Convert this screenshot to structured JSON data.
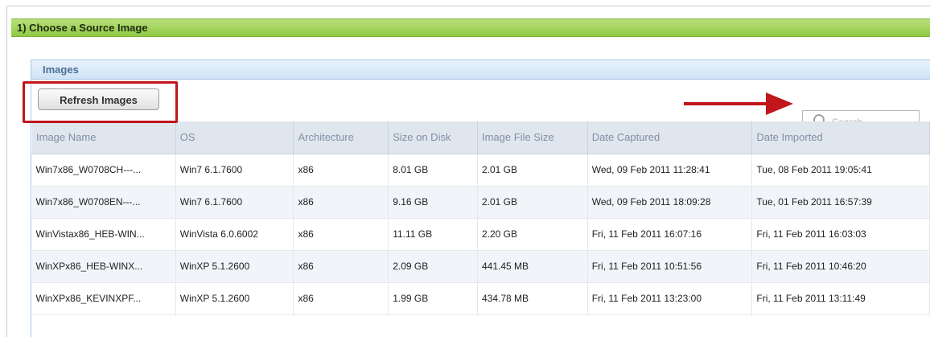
{
  "section": {
    "title": "1) Choose a Source Image"
  },
  "panel": {
    "title": "Images"
  },
  "toolbar": {
    "refresh_label": "Refresh Images"
  },
  "search": {
    "placeholder": "Search"
  },
  "colors": {
    "section_header": "#8fc944",
    "panel_border": "#a9c8e6",
    "highlight": "#c0161c"
  },
  "icons": {
    "search": "search-icon",
    "arrow": "red-arrow-annotation"
  },
  "table": {
    "columns": [
      "Image Name",
      "OS",
      "Architecture",
      "Size on Disk",
      "Image File Size",
      "Date Captured",
      "Date Imported"
    ],
    "rows": [
      [
        "Win7x86_W0708CH---...",
        "Win7 6.1.7600",
        "x86",
        "8.01 GB",
        "2.01 GB",
        "Wed, 09 Feb 2011 11:28:41",
        "Tue, 08 Feb 2011 19:05:41"
      ],
      [
        "Win7x86_W0708EN---...",
        "Win7 6.1.7600",
        "x86",
        "9.16 GB",
        "2.01 GB",
        "Wed, 09 Feb 2011 18:09:28",
        "Tue, 01 Feb 2011 16:57:39"
      ],
      [
        "WinVistax86_HEB-WIN...",
        "WinVista 6.0.6002",
        "x86",
        "11.11 GB",
        "2.20 GB",
        "Fri, 11 Feb 2011 16:07:16",
        "Fri, 11 Feb 2011 16:03:03"
      ],
      [
        "WinXPx86_HEB-WINX...",
        "WinXP 5.1.2600",
        "x86",
        "2.09 GB",
        "441.45 MB",
        "Fri, 11 Feb 2011 10:51:56",
        "Fri, 11 Feb 2011 10:46:20"
      ],
      [
        "WinXPx86_KEVINXPF...",
        "WinXP 5.1.2600",
        "x86",
        "1.99 GB",
        "434.78 MB",
        "Fri, 11 Feb 2011 13:23:00",
        "Fri, 11 Feb 2011 13:11:49"
      ]
    ]
  }
}
